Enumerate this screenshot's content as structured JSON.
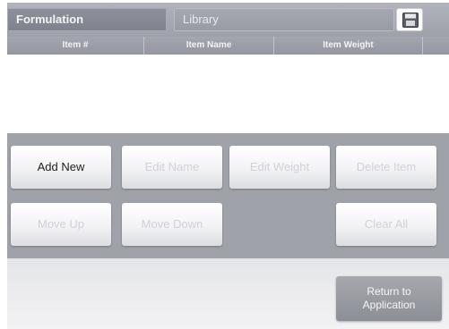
{
  "tabs": [
    {
      "label": "Formulation",
      "active": true
    },
    {
      "label": "Library",
      "active": false
    }
  ],
  "toolbar": {
    "save_icon": "floppy-disk-icon"
  },
  "table": {
    "columns": [
      "Item #",
      "Item Name",
      "Item Weight",
      ""
    ],
    "rows": []
  },
  "buttons": {
    "add_new": "Add New",
    "edit_name": "Edit Name",
    "edit_weight": "Edit Weight",
    "delete_item": "Delete Item",
    "move_up": "Move Up",
    "move_down": "Move Down",
    "clear_all": "Clear All",
    "return_line1": "Return to",
    "return_line2": "Application"
  },
  "colors": {
    "header": "#9ea1aa",
    "panel": "#9fa2a9",
    "enabled_text": "#1f1f1f",
    "disabled_text": "#d0d1d5"
  }
}
